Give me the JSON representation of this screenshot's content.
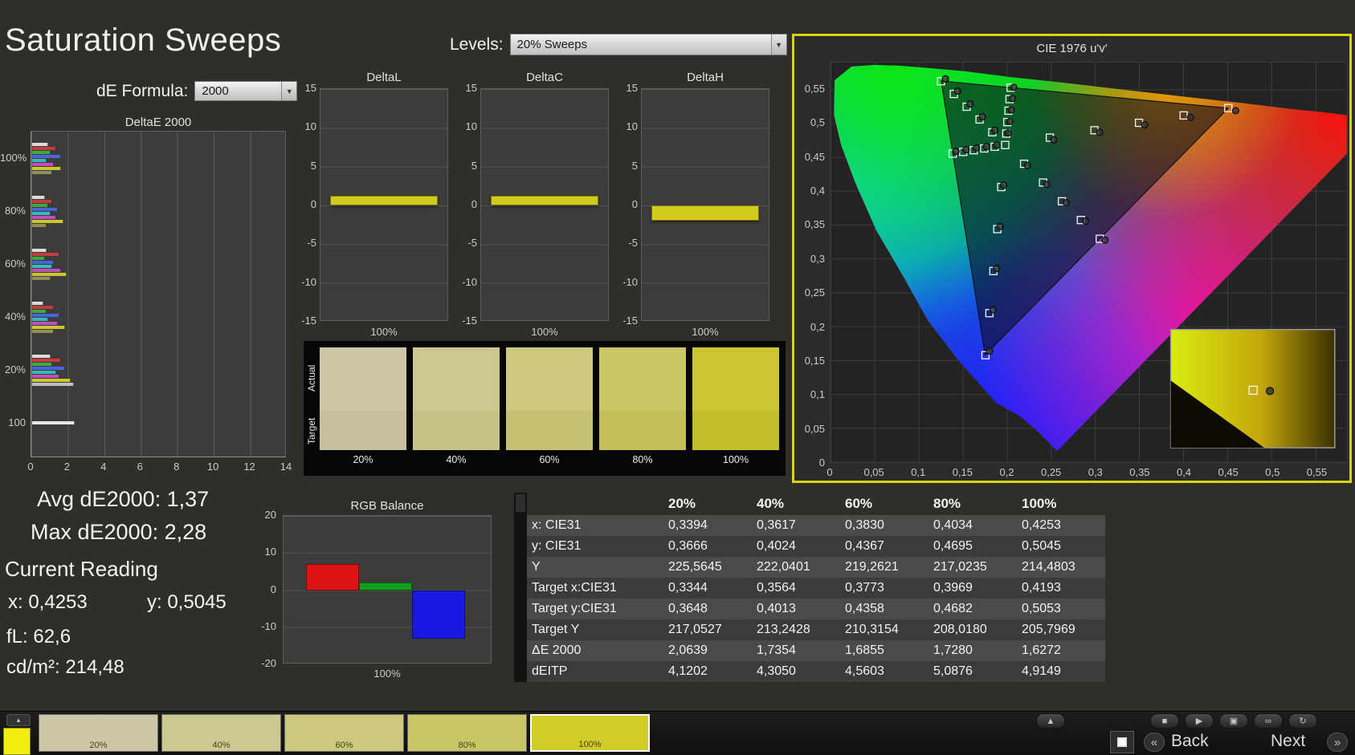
{
  "title": "Saturation Sweeps",
  "controls": {
    "de_formula": {
      "label": "dE Formula:",
      "value": "2000"
    },
    "levels": {
      "label": "Levels:",
      "value": "20% Sweeps"
    }
  },
  "colors": {
    "accent_yellow": "#d8d411",
    "bar_yellow": "#d2cc1e",
    "red": "#dd1212",
    "green": "#12a01e",
    "blue": "#1818e0"
  },
  "stats": {
    "avg": "Avg dE2000: 1,37",
    "max": "Max dE2000: 2,28",
    "current_reading_label": "Current Reading",
    "x": "x: 0,4253",
    "y": "y: 0,5045",
    "fl": "fL: 62,6",
    "cd": "cd/m²: 214,48"
  },
  "swatch_panel": {
    "row_labels": [
      "Actual",
      "Target"
    ],
    "items": [
      {
        "label": "20%",
        "actual": "#cdc7a6",
        "target": "#c6c09c"
      },
      {
        "label": "40%",
        "actual": "#cdc88f",
        "target": "#c6c185"
      },
      {
        "label": "60%",
        "actual": "#cdc97c",
        "target": "#c6c272"
      },
      {
        "label": "80%",
        "actual": "#cbc664",
        "target": "#c4bf5a"
      },
      {
        "label": "100%",
        "actual": "#cbc631",
        "target": "#c3be2c"
      }
    ]
  },
  "table": {
    "headers": [
      "20%",
      "40%",
      "60%",
      "80%",
      "100%"
    ],
    "rows": [
      {
        "label": "x: CIE31",
        "values": [
          "0,3394",
          "0,3617",
          "0,3830",
          "0,4034",
          "0,4253"
        ]
      },
      {
        "label": "y: CIE31",
        "values": [
          "0,3666",
          "0,4024",
          "0,4367",
          "0,4695",
          "0,5045"
        ]
      },
      {
        "label": "Y",
        "values": [
          "225,5645",
          "222,0401",
          "219,2621",
          "217,0235",
          "214,4803"
        ]
      },
      {
        "label": "Target x:CIE31",
        "values": [
          "0,3344",
          "0,3564",
          "0,3773",
          "0,3969",
          "0,4193"
        ]
      },
      {
        "label": "Target y:CIE31",
        "values": [
          "0,3648",
          "0,4013",
          "0,4358",
          "0,4682",
          "0,5053"
        ]
      },
      {
        "label": "Target Y",
        "values": [
          "217,0527",
          "213,2428",
          "210,3154",
          "208,0180",
          "205,7969"
        ]
      },
      {
        "label": "ΔE 2000",
        "values": [
          "2,0639",
          "1,7354",
          "1,6855",
          "1,7280",
          "1,6272"
        ]
      },
      {
        "label": "dEITP",
        "values": [
          "4,1202",
          "4,3050",
          "4,5603",
          "5,0876",
          "4,9149"
        ]
      }
    ]
  },
  "bottom_bar": {
    "swatches": [
      {
        "label": "20%",
        "color": "#cdc7a6",
        "selected": false
      },
      {
        "label": "40%",
        "color": "#cdc88f",
        "selected": false
      },
      {
        "label": "60%",
        "color": "#cdc97c",
        "selected": false
      },
      {
        "label": "80%",
        "color": "#cbc664",
        "selected": false
      },
      {
        "label": "100%",
        "color": "#d2cc2a",
        "selected": true
      }
    ],
    "transport": [
      "up",
      "stop",
      "play",
      "pattern",
      "loop",
      "refresh"
    ],
    "back": "Back",
    "next": "Next"
  },
  "chart_data": [
    {
      "id": "deltae2000",
      "type": "bar",
      "title": "DeltaE 2000",
      "orientation": "horizontal",
      "xlim": [
        0,
        14
      ],
      "x_ticks": [
        0,
        2,
        4,
        6,
        8,
        10,
        12,
        14
      ],
      "groups": [
        {
          "label": "100%",
          "bars": [
            {
              "color": "#dcdcdc",
              "value": 0.9
            },
            {
              "color": "#c43c3c",
              "value": 1.3
            },
            {
              "color": "#3cab3c",
              "value": 1.0
            },
            {
              "color": "#4b62d8",
              "value": 1.6
            },
            {
              "color": "#38b8b8",
              "value": 0.8
            },
            {
              "color": "#bf4fbf",
              "value": 1.2
            },
            {
              "color": "#cdc72e",
              "value": 1.6
            },
            {
              "color": "#8f8f5a",
              "value": 1.1
            }
          ]
        },
        {
          "label": "80%",
          "bars": [
            {
              "color": "#dcdcdc",
              "value": 0.7
            },
            {
              "color": "#c43c3c",
              "value": 1.1
            },
            {
              "color": "#3cab3c",
              "value": 0.9
            },
            {
              "color": "#4b62d8",
              "value": 1.4
            },
            {
              "color": "#38b8b8",
              "value": 1.0
            },
            {
              "color": "#bf4fbf",
              "value": 1.3
            },
            {
              "color": "#cdc72e",
              "value": 1.7
            },
            {
              "color": "#8f8f5a",
              "value": 0.8
            }
          ]
        },
        {
          "label": "60%",
          "bars": [
            {
              "color": "#dcdcdc",
              "value": 0.8
            },
            {
              "color": "#c43c3c",
              "value": 1.5
            },
            {
              "color": "#3cab3c",
              "value": 0.7
            },
            {
              "color": "#4b62d8",
              "value": 1.2
            },
            {
              "color": "#38b8b8",
              "value": 1.1
            },
            {
              "color": "#bf4fbf",
              "value": 1.6
            },
            {
              "color": "#cdc72e",
              "value": 1.9
            },
            {
              "color": "#8f8f5a",
              "value": 1.0
            }
          ]
        },
        {
          "label": "40%",
          "bars": [
            {
              "color": "#dcdcdc",
              "value": 0.6
            },
            {
              "color": "#c43c3c",
              "value": 1.2
            },
            {
              "color": "#3cab3c",
              "value": 0.8
            },
            {
              "color": "#4b62d8",
              "value": 1.5
            },
            {
              "color": "#38b8b8",
              "value": 0.9
            },
            {
              "color": "#bf4fbf",
              "value": 1.4
            },
            {
              "color": "#cdc72e",
              "value": 1.8
            },
            {
              "color": "#8f8f5a",
              "value": 1.2
            }
          ]
        },
        {
          "label": "20%",
          "bars": [
            {
              "color": "#dcdcdc",
              "value": 1.0
            },
            {
              "color": "#c43c3c",
              "value": 1.6
            },
            {
              "color": "#3cab3c",
              "value": 1.1
            },
            {
              "color": "#4b62d8",
              "value": 1.8
            },
            {
              "color": "#38b8b8",
              "value": 1.3
            },
            {
              "color": "#bf4fbf",
              "value": 1.5
            },
            {
              "color": "#cdc72e",
              "value": 2.1
            },
            {
              "color": "#bfbfbf",
              "value": 2.3
            }
          ]
        },
        {
          "label": "100",
          "bars": [
            {
              "color": "#e8e8e8",
              "value": 2.35
            }
          ]
        }
      ]
    },
    {
      "id": "deltaL",
      "type": "bar",
      "title": "DeltaL",
      "x_label": "100%",
      "ylim": [
        -15,
        15
      ],
      "y_ticks": [
        15,
        10,
        5,
        0,
        -5,
        -10,
        -15
      ],
      "value": 1.2
    },
    {
      "id": "deltaC",
      "type": "bar",
      "title": "DeltaC",
      "x_label": "100%",
      "ylim": [
        -15,
        15
      ],
      "y_ticks": [
        15,
        10,
        5,
        0,
        -5,
        -10,
        -15
      ],
      "value": 1.2
    },
    {
      "id": "deltaH",
      "type": "bar",
      "title": "DeltaH",
      "x_label": "100%",
      "ylim": [
        -15,
        15
      ],
      "y_ticks": [
        15,
        10,
        5,
        0,
        -5,
        -10,
        -15
      ],
      "value": -2.0
    },
    {
      "id": "rgb_balance",
      "type": "bar",
      "title": "RGB Balance",
      "x_label": "100%",
      "ylim": [
        -20,
        20
      ],
      "y_ticks": [
        20,
        10,
        0,
        -10,
        -20
      ],
      "series": [
        {
          "name": "red",
          "value": 7
        },
        {
          "name": "green",
          "value": 2
        },
        {
          "name": "blue",
          "value": -13
        }
      ]
    },
    {
      "id": "cie",
      "type": "scatter",
      "title": "CIE 1976 u'v'",
      "xlim": [
        0,
        0.585
      ],
      "ylim": [
        0,
        0.59
      ],
      "grid_step": 0.05,
      "tick_labels": [
        "0",
        "0,05",
        "0,1",
        "0,15",
        "0,2",
        "0,25",
        "0,3",
        "0,35",
        "0,4",
        "0,45",
        "0,5",
        "0,55"
      ],
      "white_point": [
        0.1978,
        0.4683
      ],
      "sweeps": [
        {
          "name": "red",
          "targets": [
            [
              0.2484,
              0.4792
            ],
            [
              0.299,
              0.4901
            ],
            [
              0.3495,
              0.5011
            ],
            [
              0.4001,
              0.512
            ],
            [
              0.4507,
              0.5229
            ]
          ],
          "measured": [
            [
              0.253,
              0.476
            ],
            [
              0.305,
              0.487
            ],
            [
              0.356,
              0.498
            ],
            [
              0.408,
              0.509
            ],
            [
              0.459,
              0.519
            ]
          ]
        },
        {
          "name": "green",
          "targets": [
            [
              0.1832,
              0.4871
            ],
            [
              0.1687,
              0.506
            ],
            [
              0.1541,
              0.5248
            ],
            [
              0.1396,
              0.5437
            ],
            [
              0.125,
              0.5625
            ]
          ],
          "measured": [
            [
              0.186,
              0.49
            ],
            [
              0.172,
              0.51
            ],
            [
              0.158,
              0.529
            ],
            [
              0.144,
              0.548
            ],
            [
              0.13,
              0.566
            ]
          ]
        },
        {
          "name": "blue",
          "targets": [
            [
              0.1933,
              0.4062
            ],
            [
              0.1888,
              0.3441
            ],
            [
              0.1844,
              0.2821
            ],
            [
              0.1799,
              0.22
            ],
            [
              0.1754,
              0.1579
            ]
          ],
          "measured": [
            [
              0.196,
              0.409
            ],
            [
              0.192,
              0.348
            ],
            [
              0.188,
              0.286
            ],
            [
              0.184,
              0.225
            ],
            [
              0.18,
              0.164
            ]
          ]
        },
        {
          "name": "cyan",
          "targets": [
            [
              0.1859,
              0.4657
            ],
            [
              0.174,
              0.4632
            ],
            [
              0.1621,
              0.4606
            ],
            [
              0.1502,
              0.4581
            ],
            [
              0.1383,
              0.4555
            ]
          ],
          "measured": [
            [
              0.188,
              0.468
            ],
            [
              0.1765,
              0.466
            ],
            [
              0.165,
              0.464
            ],
            [
              0.1535,
              0.4615
            ],
            [
              0.142,
              0.459
            ]
          ]
        },
        {
          "name": "magenta",
          "targets": [
            [
              0.2192,
              0.4406
            ],
            [
              0.2407,
              0.4129
            ],
            [
              0.2621,
              0.3852
            ],
            [
              0.2836,
              0.3575
            ],
            [
              0.305,
              0.3298
            ]
          ],
          "measured": [
            [
              0.223,
              0.438
            ],
            [
              0.245,
              0.41
            ],
            [
              0.267,
              0.383
            ],
            [
              0.289,
              0.356
            ],
            [
              0.311,
              0.328
            ]
          ]
        },
        {
          "name": "yellow",
          "targets": [
            [
              0.199,
              0.4852
            ],
            [
              0.2002,
              0.5021
            ],
            [
              0.2015,
              0.519
            ],
            [
              0.2027,
              0.536
            ],
            [
              0.2039,
              0.5529
            ]
          ],
          "measured": [
            [
              0.201,
              0.486
            ],
            [
              0.203,
              0.503
            ],
            [
              0.2045,
              0.52
            ],
            [
              0.206,
              0.537
            ],
            [
              0.2074,
              0.5535
            ]
          ]
        }
      ]
    }
  ]
}
